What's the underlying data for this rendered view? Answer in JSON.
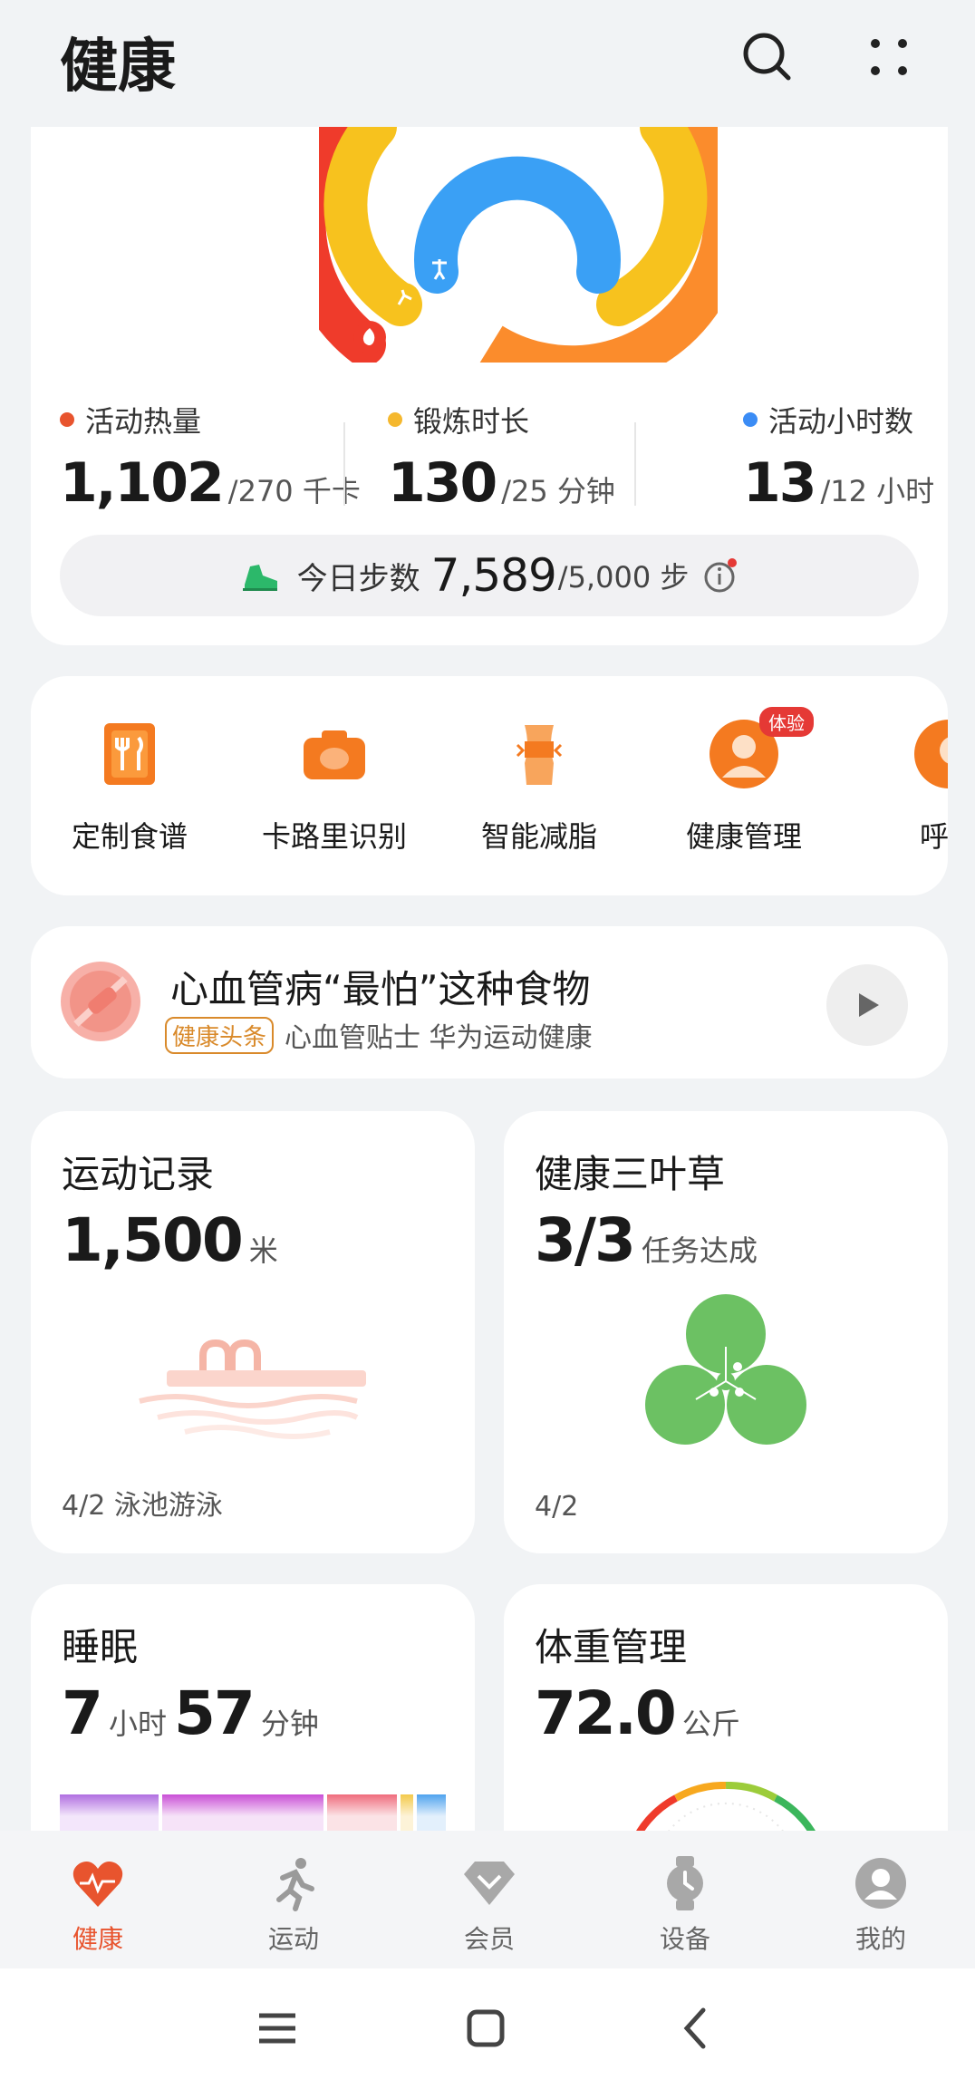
{
  "header": {
    "title": "健康"
  },
  "rings": {
    "metrics": [
      {
        "label": "活动热量",
        "value": "1,102",
        "goal": "/270 千卡",
        "color": "#e8542e"
      },
      {
        "label": "锻炼时长",
        "value": "130",
        "goal": "/25 分钟",
        "color": "#f5b82e"
      },
      {
        "label": "活动小时数",
        "value": "13",
        "goal": "/12 小时",
        "color": "#3b8cf5"
      }
    ],
    "steps": {
      "label": "今日步数",
      "value": "7,589",
      "goal": "/5,000 步"
    }
  },
  "functions": [
    {
      "label": "定制食谱",
      "icon": "recipe-icon"
    },
    {
      "label": "卡路里识别",
      "icon": "camera-icon"
    },
    {
      "label": "智能减脂",
      "icon": "body-icon"
    },
    {
      "label": "健康管理",
      "icon": "doctor-icon",
      "badge": "体验"
    },
    {
      "label": "呼吸",
      "icon": "breath-icon"
    }
  ],
  "news": {
    "title": "心血管病“最怕”这种食物",
    "tag": "健康头条",
    "source": "心血管贴士 华为运动健康"
  },
  "tiles": {
    "sport": {
      "title": "运动记录",
      "value": "1,500",
      "unit": "米",
      "footer": "4/2 泳池游泳"
    },
    "clover": {
      "title": "健康三叶草",
      "value": "3/3",
      "unit": "任务达成",
      "footer": "4/2"
    },
    "sleep": {
      "title": "睡眠",
      "hours": "7",
      "hours_unit": "小时",
      "minutes": "57",
      "minutes_unit": "分钟"
    },
    "weight": {
      "title": "体重管理",
      "value": "72.0",
      "unit": "公斤"
    }
  },
  "tabs": [
    {
      "label": "健康",
      "active": true
    },
    {
      "label": "运动",
      "active": false
    },
    {
      "label": "会员",
      "active": false
    },
    {
      "label": "设备",
      "active": false
    },
    {
      "label": "我的",
      "active": false
    }
  ],
  "colors": {
    "accent": "#e8542e",
    "ring_red": "#ef3b2b",
    "ring_yellow": "#f7c21e",
    "ring_blue": "#3aa0f5",
    "ring_orange": "#fb8c2c"
  }
}
